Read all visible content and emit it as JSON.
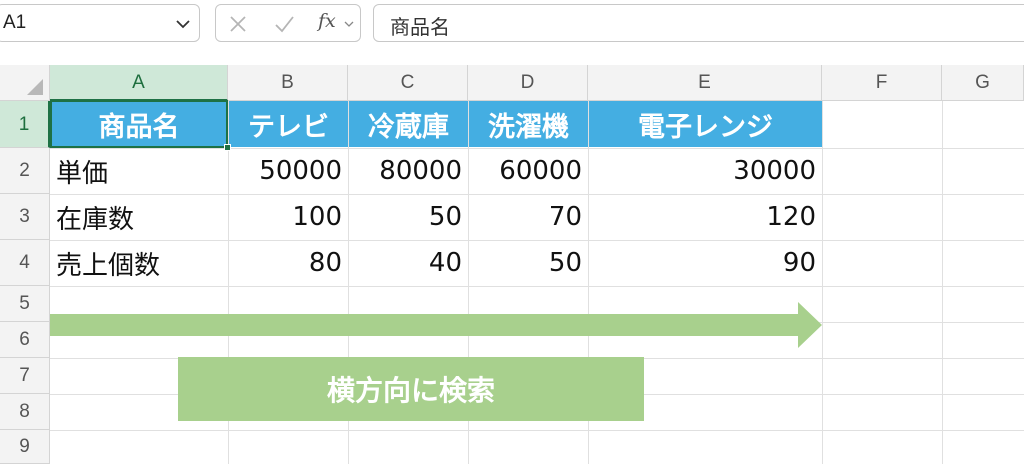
{
  "formula_bar": {
    "name_box": "A1",
    "fx_label": "fx",
    "formula": "商品名"
  },
  "columns": [
    "A",
    "B",
    "C",
    "D",
    "E",
    "F",
    "G"
  ],
  "rows": [
    "1",
    "2",
    "3",
    "4",
    "5",
    "6",
    "7",
    "8",
    "9"
  ],
  "table": {
    "header": [
      "商品名",
      "テレビ",
      "冷蔵庫",
      "洗濯機",
      "電子レンジ"
    ],
    "rows": [
      [
        "単価",
        "50000",
        "80000",
        "60000",
        "30000"
      ],
      [
        "在庫数",
        "100",
        "50",
        "70",
        "120"
      ],
      [
        "売上個数",
        "80",
        "40",
        "50",
        "90"
      ]
    ]
  },
  "annotation": {
    "label": "横方向に検索"
  },
  "colors": {
    "header_fill": "#44aee2",
    "annotation_fill": "#a8d08d",
    "selection": "#1e7145"
  }
}
